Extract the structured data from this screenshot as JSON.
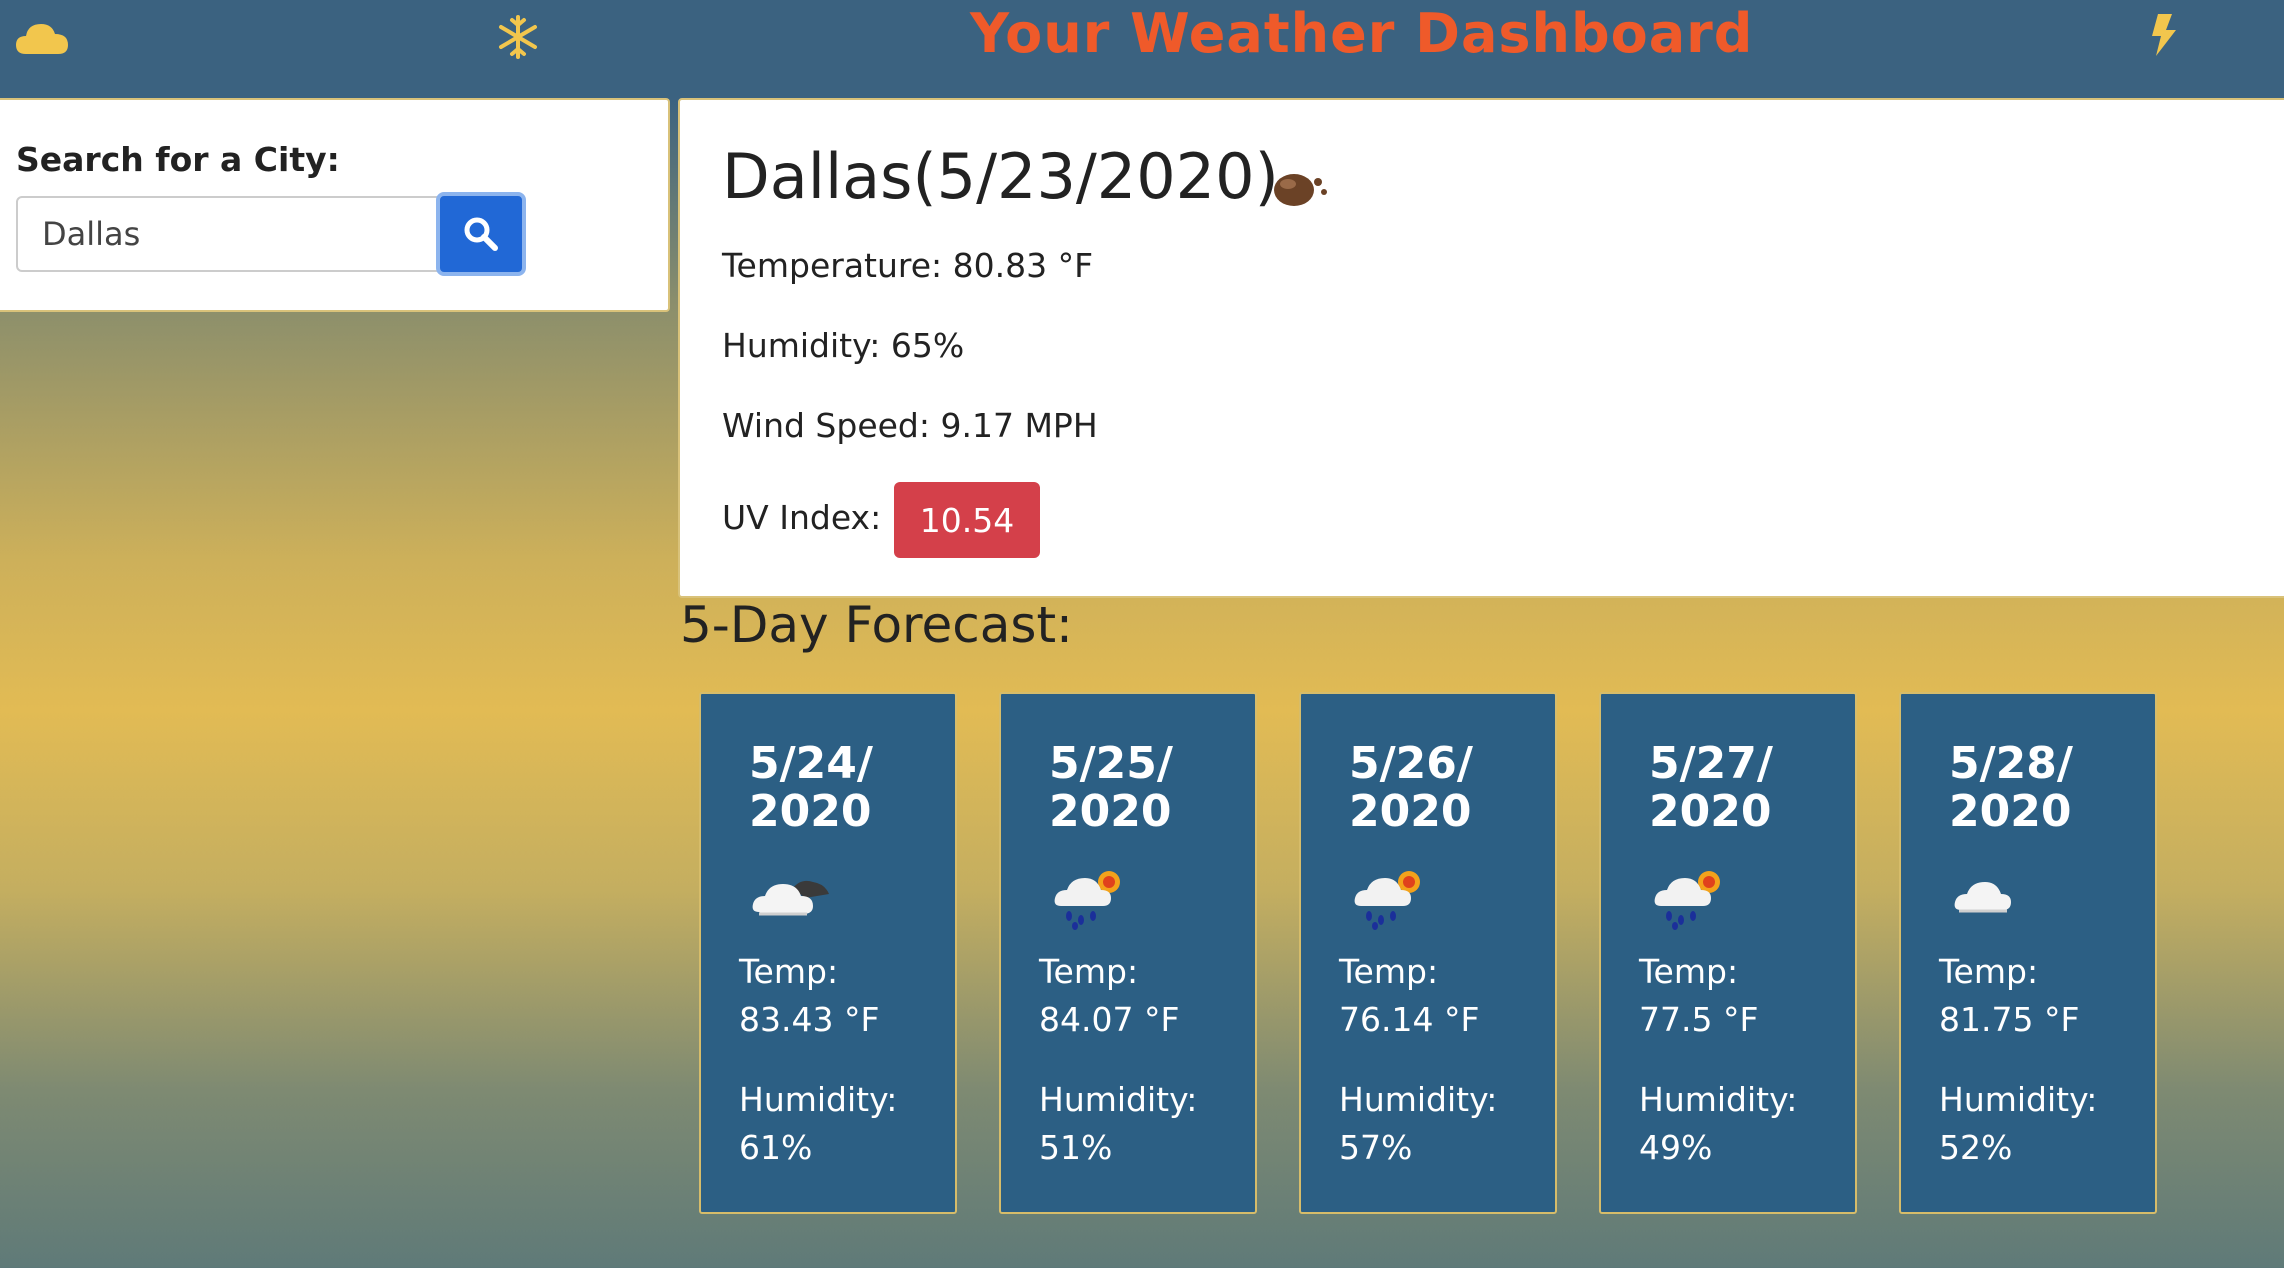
{
  "header": {
    "title": "Your Weather Dashboard",
    "icons": [
      "cloud-icon",
      "snowflake-icon",
      "lightning-bolt-icon"
    ],
    "title_color": "#ef5a2a",
    "icon_color": "#f2c64d",
    "background": "#3b6280"
  },
  "search": {
    "label": "Search for a City:",
    "value": "Dallas",
    "button_icon": "search-icon",
    "button_color": "#2168d6"
  },
  "current": {
    "title": "Dallas(5/23/2020)",
    "icon": "haze-icon",
    "temperature": "Temperature: 80.83 °F",
    "humidity": "Humidity: 65%",
    "wind": "Wind Speed: 9.17 MPH",
    "uv_label": "UV Index:",
    "uv_value": "10.54",
    "uv_color": "#d4404a"
  },
  "forecast": {
    "heading": "5-Day Forecast:",
    "card_color": "#2c5f84",
    "temp_label": "Temp:",
    "humidity_label": "Humidity:",
    "days": [
      {
        "date": "5/24/ 2020",
        "icon": "cloudy-night-icon",
        "temp": "83.43 °F",
        "humidity": "61%"
      },
      {
        "date": "5/25/ 2020",
        "icon": "rain-sun-icon",
        "temp": "84.07 °F",
        "humidity": "51%"
      },
      {
        "date": "5/26/ 2020",
        "icon": "rain-sun-icon",
        "temp": "76.14 °F",
        "humidity": "57%"
      },
      {
        "date": "5/27/ 2020",
        "icon": "rain-sun-icon",
        "temp": "77.5 °F",
        "humidity": "49%"
      },
      {
        "date": "5/28/ 2020",
        "icon": "cloud-icon",
        "temp": "81.75 °F",
        "humidity": "52%"
      }
    ]
  }
}
